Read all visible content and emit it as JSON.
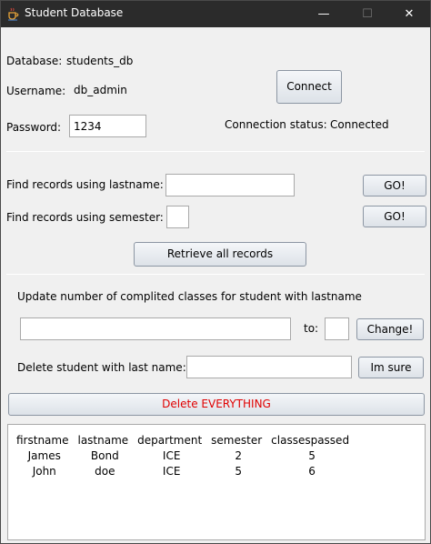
{
  "window": {
    "title": "Student Database",
    "min_glyph": "—",
    "max_glyph": "☐",
    "close_glyph": "✕"
  },
  "connection": {
    "database_label": "Database:",
    "database_value": "students_db",
    "username_label": "Username:",
    "username_value": "db_admin",
    "password_label": "Password:",
    "password_value": "1234",
    "connect_button": "Connect",
    "status_label": "Connection status:",
    "status_value": "Connected"
  },
  "search": {
    "lastname_label": "Find records using lastname:",
    "lastname_value": "",
    "lastname_go": "GO!",
    "semester_label": "Find records using semester:",
    "semester_value": "",
    "semester_go": "GO!",
    "retrieve_all": "Retrieve all records"
  },
  "update": {
    "title": "Update number of complited classes for student with lastname",
    "lastname_value": "",
    "to_label": "to:",
    "count_value": "",
    "change_button": "Change!"
  },
  "delete": {
    "label": "Delete student with last name:",
    "lastname_value": "",
    "confirm_button": "Im sure",
    "delete_all_button": "Delete EVERYTHING",
    "delete_all_color": "#e00000"
  },
  "results": {
    "columns": [
      "firstname",
      "lastname",
      "department",
      "semester",
      "classespassed"
    ],
    "rows": [
      [
        "James",
        "Bond",
        "ICE",
        "2",
        "5"
      ],
      [
        "John",
        "doe",
        "ICE",
        "5",
        "6"
      ]
    ]
  }
}
